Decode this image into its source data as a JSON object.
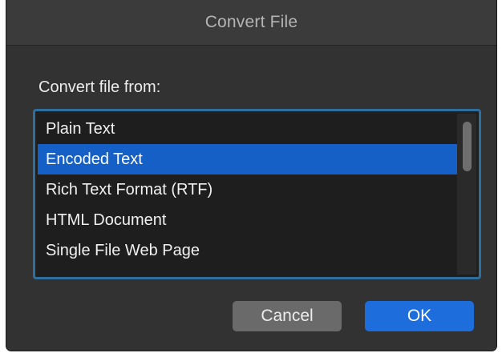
{
  "dialog": {
    "title": "Convert File",
    "prompt": "Convert file from:",
    "formats": [
      "Plain Text",
      "Encoded Text",
      "Rich Text Format (RTF)",
      "HTML Document",
      "Single File Web Page"
    ],
    "selected_format": "Encoded Text",
    "cancel_label": "Cancel",
    "ok_label": "OK"
  },
  "colors": {
    "dialog_background": "#323232",
    "selection": "#1460c6",
    "focus_ring": "#2e6f9e",
    "default_button": "#1d6ddc"
  }
}
